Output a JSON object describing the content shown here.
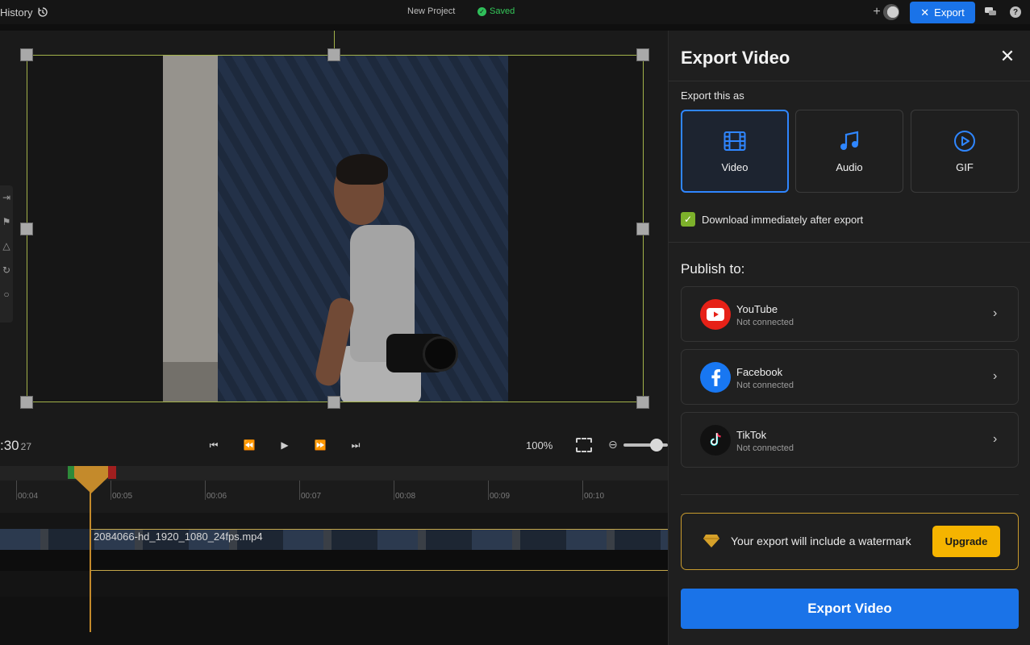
{
  "topbar": {
    "history_label": "History",
    "project_title": "New Project",
    "saved_label": "Saved",
    "export_label": "Export",
    "icons": [
      "history-icon",
      "add-collaborator-icon",
      "avatar",
      "chat-icon",
      "help-icon"
    ]
  },
  "player": {
    "timecode": ":30",
    "frames": "27",
    "zoom": "100%",
    "icons": [
      "skip-start-icon",
      "rewind-icon",
      "play-icon",
      "fast-forward-icon",
      "skip-end-icon",
      "fullscreen-icon",
      "zoom-out-icon"
    ]
  },
  "timeline": {
    "ticks": [
      "00:04",
      "00:05",
      "00:06",
      "00:07",
      "00:08",
      "00:09",
      "00:10"
    ],
    "clip_name": "2084066-hd_1920_1080_24fps.mp4"
  },
  "panel": {
    "title": "Export Video",
    "export_as_label": "Export this as",
    "types": [
      {
        "label": "Video",
        "icon": "film-icon",
        "selected": true
      },
      {
        "label": "Audio",
        "icon": "music-note-icon",
        "selected": false
      },
      {
        "label": "GIF",
        "icon": "play-circle-icon",
        "selected": false
      }
    ],
    "download_after_export": "Download immediately after export",
    "publish_title": "Publish to:",
    "publish": [
      {
        "name": "YouTube",
        "status": "Not connected",
        "color": "#e62117"
      },
      {
        "name": "Facebook",
        "status": "Not connected",
        "color": "#1877f2"
      },
      {
        "name": "TikTok",
        "status": "Not connected",
        "color": "#111111"
      }
    ],
    "watermark_text": "Your export will include a watermark",
    "upgrade_label": "Upgrade",
    "export_button_label": "Export Video"
  },
  "colors": {
    "accent": "#1a73e8",
    "selection_outline": "#a3b24a",
    "watermark_border": "#c79a2e",
    "upgrade_bg": "#f5b400",
    "saved": "#34c759"
  }
}
